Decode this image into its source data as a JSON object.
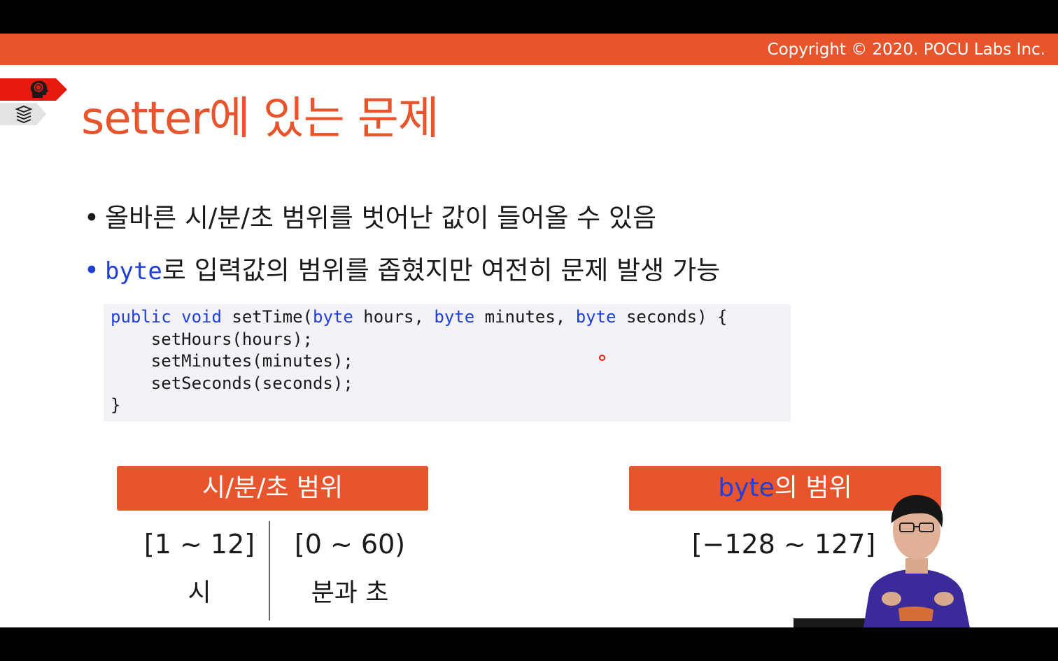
{
  "header": {
    "copyright": "Copyright © 2020. POCU Labs Inc."
  },
  "icons": {
    "top_tab": "brain-icon",
    "bottom_tab": "books-icon"
  },
  "slide": {
    "title": "setter에 있는 문제",
    "bullets": [
      {
        "dot": "•",
        "text": "올바른 시/분/초 범위를 벗어난 값이 들어올 수 있음"
      },
      {
        "dot": "•",
        "keyword": "byte",
        "text": "로 입력값의 범위를 좁혔지만 여전히 문제 발생 가능"
      }
    ],
    "code": {
      "line1": {
        "kw1": "public",
        "kw2": "void",
        "name": "setTime(",
        "kw3": "byte",
        "p1": "hours,",
        "kw4": "byte",
        "p2": "minutes,",
        "kw5": "byte",
        "p3": "seconds) {"
      },
      "line2": "    setHours(hours);",
      "line3": "    setMinutes(minutes);",
      "line4": "    setSeconds(seconds);",
      "line5": "}"
    },
    "range_box": {
      "heading": "시/분/초 범위",
      "hours_range": "[1 ~ 12]",
      "hours_label": "시",
      "minsec_range": "[0 ~ 60)",
      "minsec_label": "분과 초"
    },
    "byte_box": {
      "heading_keyword": "byte",
      "heading_rest": "의 범위",
      "range": "[−128 ~ 127]"
    }
  },
  "colors": {
    "accent": "#e8552d",
    "keyword": "#1f3fd8",
    "tag_red": "#e8190e",
    "code_bg": "#f2f2f7"
  }
}
